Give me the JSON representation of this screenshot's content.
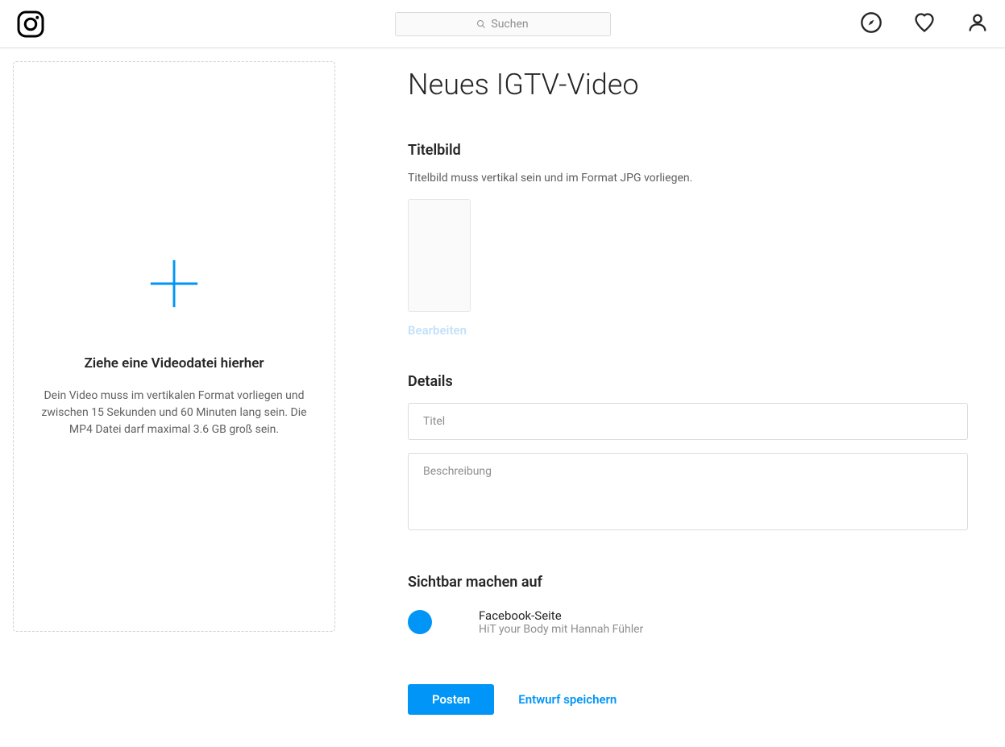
{
  "nav": {
    "search_placeholder": "Suchen"
  },
  "dropzone": {
    "title": "Ziehe eine Videodatei hierher",
    "subtitle": "Dein Video muss im vertikalen Format vorliegen und zwischen 15 Sekunden und 60 Minuten lang sein. Die MP4 Datei darf maximal 3.6 GB groß sein."
  },
  "page": {
    "title": "Neues IGTV-Video"
  },
  "cover": {
    "section_title": "Titelbild",
    "section_subtitle": "Titelbild muss vertikal sein und im Format JPG vorliegen.",
    "edit_label": "Bearbeiten"
  },
  "details": {
    "section_title": "Details",
    "title_placeholder": "Titel",
    "description_placeholder": "Beschreibung"
  },
  "visibility": {
    "section_title": "Sichtbar machen auf",
    "fb_title": "Facebook-Seite",
    "fb_subtitle": "HiT your Body mit Hannah Fühler"
  },
  "actions": {
    "post": "Posten",
    "save_draft": "Entwurf speichern"
  }
}
